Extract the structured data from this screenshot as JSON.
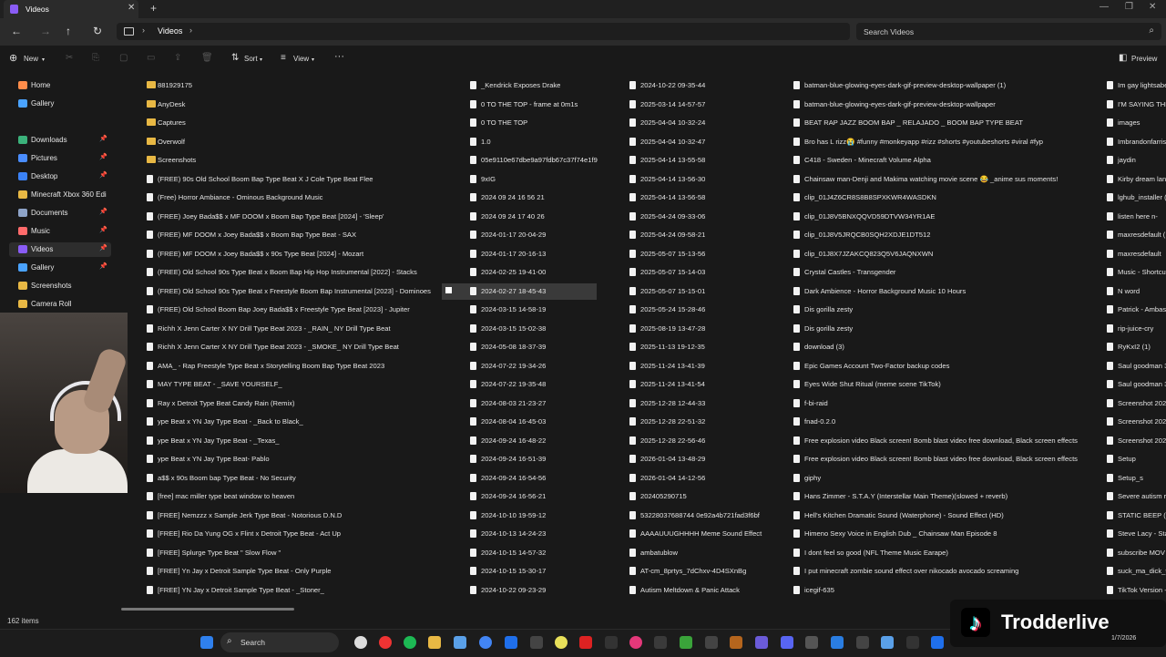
{
  "window": {
    "tab_title": "Videos",
    "new_tab": "+"
  },
  "address": {
    "crumb": "Videos",
    "search_placeholder": "Search Videos"
  },
  "toolbar": {
    "new": "New",
    "sort": "Sort",
    "view": "View",
    "more": "···",
    "preview": "Preview"
  },
  "sidebar": {
    "items": [
      {
        "label": "Home",
        "color": "#ff8c4a"
      },
      {
        "label": "Gallery",
        "color": "#4aa3ff"
      },
      {
        "label": "Downloads",
        "color": "#3bb27b"
      },
      {
        "label": "Pictures",
        "color": "#4a8dff"
      },
      {
        "label": "Desktop",
        "color": "#3b82f6"
      },
      {
        "label": "Minecraft Xbox 360 Edi",
        "color": "#e8b844"
      },
      {
        "label": "Documents",
        "color": "#8ea4c8"
      },
      {
        "label": "Music",
        "color": "#ff6b6b"
      },
      {
        "label": "Videos",
        "color": "#8a5cf6"
      },
      {
        "label": "Gallery",
        "color": "#4aa3ff"
      },
      {
        "label": "Screenshots",
        "color": "#e8b844"
      },
      {
        "label": "Camera Roll",
        "color": "#e8b844"
      }
    ]
  },
  "columns": [
    {
      "rows": [
        {
          "name": "881929175",
          "type": "folder"
        },
        {
          "name": "AnyDesk",
          "type": "folder"
        },
        {
          "name": "Captures",
          "type": "folder"
        },
        {
          "name": "Overwolf",
          "type": "folder"
        },
        {
          "name": "Screenshots",
          "type": "folder"
        },
        {
          "name": "(FREE) 90s Old School Boom Bap Type Beat X J Cole Type Beat  Flee",
          "type": "file"
        },
        {
          "name": "(Free) Horror Ambiance - Ominous Background Music",
          "type": "file"
        },
        {
          "name": "(FREE) Joey Bada$$ x MF DOOM x Boom Bap Type Beat [2024] - 'Sleep'",
          "type": "file"
        },
        {
          "name": "(FREE) MF DOOM x Joey Bada$$ x Boom Bap Type Beat -  SAX",
          "type": "file"
        },
        {
          "name": "(FREE) MF DOOM x Joey Bada$$ x 90s Type Beat [2024] -  Mozart",
          "type": "file"
        },
        {
          "name": "(FREE) Old School 90s Type Beat x Boom Bap Hip Hop Instrumental [2022] - Stacks",
          "type": "file"
        },
        {
          "name": "(FREE) Old School 90s Type Beat x Freestyle Boom Bap Instrumental [2023] - Dominoes",
          "type": "file"
        },
        {
          "name": "(FREE) Old School Boom Bap Joey Bada$$ x Freestyle Type Beat [2023] - Jupiter",
          "type": "file"
        },
        {
          "name": "Richh X Jenn Carter X NY Drill Type Beat 2023 - _RAIN_ NY Drill Type Beat",
          "type": "file"
        },
        {
          "name": "Richh X Jenn Carter X NY Drill Type Beat 2023 - _SMOKE_ NY Drill Type Beat",
          "type": "file"
        },
        {
          "name": "AMA_ - Rap Freestyle Type Beat x Storytelling Boom Bap Type Beat 2023",
          "type": "file"
        },
        {
          "name": "MAY TYPE BEAT - _SAVE YOURSELF_",
          "type": "file"
        },
        {
          "name": "Ray x Detroit Type Beat  Candy Rain  (Remix)",
          "type": "file"
        },
        {
          "name": "ype Beat x YN Jay Type Beat - _Back to Black_",
          "type": "file"
        },
        {
          "name": "ype Beat x YN Jay Type Beat - _Texas_",
          "type": "file"
        },
        {
          "name": "ype Beat x YN Jay Type Beat-  Pablo",
          "type": "file"
        },
        {
          "name": "a$$ x 90s Boom bap Type Beat -  No Security",
          "type": "file"
        },
        {
          "name": "[free] mac miller type beat  window to heaven",
          "type": "file"
        },
        {
          "name": "[FREE] Nemzzz x Sample Jerk Type Beat -  Notorious D.N.D",
          "type": "file"
        },
        {
          "name": "[FREE] Rio Da Yung OG x Flint x Detroit Type Beat -  Act Up",
          "type": "file"
        },
        {
          "name": "[FREE] Splurge Type Beat  \" Slow Flow \"",
          "type": "file"
        },
        {
          "name": "[FREE] Yn Jay x Detroit Sample Type Beat -  Only Purple",
          "type": "file"
        },
        {
          "name": "[FREE] YN Jay x Detroit Sample Type Beat - _Stoner_",
          "type": "file"
        }
      ]
    },
    {
      "rows": [
        {
          "name": "_Kendrick Exposes Drake",
          "type": "file"
        },
        {
          "name": "0 TO THE TOP - frame at 0m1s",
          "type": "file"
        },
        {
          "name": "0 TO THE TOP",
          "type": "file"
        },
        {
          "name": "1.0",
          "type": "file"
        },
        {
          "name": "05e9110e67dbe9a97fdb67c37f74e1f9",
          "type": "file"
        },
        {
          "name": "9xIG",
          "type": "file"
        },
        {
          "name": "2024 09 24 16 56 21",
          "type": "file"
        },
        {
          "name": "2024 09 24 17 40 26",
          "type": "file"
        },
        {
          "name": "2024-01-17 20-04-29",
          "type": "file"
        },
        {
          "name": "2024-01-17 20-16-13",
          "type": "file"
        },
        {
          "name": "2024-02-25 19-41-00",
          "type": "file"
        },
        {
          "name": "2024-02-27 18-45-43",
          "type": "file"
        },
        {
          "name": "2024-03-15 14-58-19",
          "type": "file"
        },
        {
          "name": "2024-03-15 15-02-38",
          "type": "file"
        },
        {
          "name": "2024-05-08 18-37-39",
          "type": "file"
        },
        {
          "name": "2024-07-22 19-34-26",
          "type": "file"
        },
        {
          "name": "2024-07-22 19-35-48",
          "type": "file"
        },
        {
          "name": "2024-08-03 21-23-27",
          "type": "file"
        },
        {
          "name": "2024-08-04 16-45-03",
          "type": "file"
        },
        {
          "name": "2024-09-24 16-48-22",
          "type": "file"
        },
        {
          "name": "2024-09-24 16-51-39",
          "type": "file"
        },
        {
          "name": "2024-09-24 16-54-56",
          "type": "file"
        },
        {
          "name": "2024-09-24 16-56-21",
          "type": "file"
        },
        {
          "name": "2024-10-10 19-59-12",
          "type": "file"
        },
        {
          "name": "2024-10-13 14-24-23",
          "type": "file"
        },
        {
          "name": "2024-10-15 14-57-32",
          "type": "file"
        },
        {
          "name": "2024-10-15 15-30-17",
          "type": "file"
        },
        {
          "name": "2024-10-22 09-23-29",
          "type": "file"
        }
      ]
    },
    {
      "rows": [
        {
          "name": "2024-10-22 09-35-44",
          "type": "file"
        },
        {
          "name": "2025-03-14 14-57-57",
          "type": "file"
        },
        {
          "name": "2025-04-04 10-32-24",
          "type": "file"
        },
        {
          "name": "2025-04-04 10-32-47",
          "type": "file"
        },
        {
          "name": "2025-04-14 13-55-58",
          "type": "file"
        },
        {
          "name": "2025-04-14 13-56-30",
          "type": "file"
        },
        {
          "name": "2025-04-14 13-56-58",
          "type": "file"
        },
        {
          "name": "2025-04-24 09-33-06",
          "type": "file"
        },
        {
          "name": "2025-04-24 09-58-21",
          "type": "file"
        },
        {
          "name": "2025-05-07 15-13-56",
          "type": "file"
        },
        {
          "name": "2025-05-07 15-14-03",
          "type": "file"
        },
        {
          "name": "2025-05-07 15-15-01",
          "type": "file"
        },
        {
          "name": "2025-05-24 15-28-46",
          "type": "file"
        },
        {
          "name": "2025-08-19 13-47-28",
          "type": "file"
        },
        {
          "name": "2025-11-13 19-12-35",
          "type": "file"
        },
        {
          "name": "2025-11-24 13-41-39",
          "type": "file"
        },
        {
          "name": "2025-11-24 13-41-54",
          "type": "file"
        },
        {
          "name": "2025-12-28 12-44-33",
          "type": "file"
        },
        {
          "name": "2025-12-28 22-51-32",
          "type": "file"
        },
        {
          "name": "2025-12-28 22-56-46",
          "type": "file"
        },
        {
          "name": "2026-01-04 13-48-29",
          "type": "file"
        },
        {
          "name": "2026-01-04 14-12-56",
          "type": "file"
        },
        {
          "name": "202405290715",
          "type": "file"
        },
        {
          "name": "53228037688744 0e92a4b721fad3f6bf",
          "type": "file"
        },
        {
          "name": "AAAAUUUGHHHH Meme Sound Effect",
          "type": "file"
        },
        {
          "name": "ambatublow",
          "type": "file"
        },
        {
          "name": "AT-cm_8prtys_7dChxv-4D4SXnBg",
          "type": "file"
        },
        {
          "name": "Autism Meltdown & Panic Attack",
          "type": "file"
        }
      ]
    },
    {
      "rows": [
        {
          "name": "batman-blue-glowing-eyes-dark-gif-preview-desktop-wallpaper (1)",
          "type": "file"
        },
        {
          "name": "batman-blue-glowing-eyes-dark-gif-preview-desktop-wallpaper",
          "type": "file"
        },
        {
          "name": "BEAT RAP JAZZ BOOM BAP _ RELAJADO _ BOOM BAP TYPE BEAT",
          "type": "file"
        },
        {
          "name": "Bro has L rizz😭 #funny #monkeyapp #rizz #shorts #youtubeshorts #viral #fyp",
          "type": "file"
        },
        {
          "name": "C418  - Sweden - Minecraft Volume Alpha",
          "type": "file"
        },
        {
          "name": "Chainsaw man-Denji and Makima watching movie scene 😂 _anime sus moments!",
          "type": "file"
        },
        {
          "name": "clip_01J4Z6CR8S8B8SPXKWR4WASDKN",
          "type": "file"
        },
        {
          "name": "clip_01J8V5BNXQQVD59DTVW34YR1AE",
          "type": "file"
        },
        {
          "name": "clip_01J8V5JRQCB0SQH2XDJE1DT512",
          "type": "file"
        },
        {
          "name": "clip_01J8X7JZAKCQ823Q5V6JAQNXWN",
          "type": "file"
        },
        {
          "name": "Crystal Castles - Transgender",
          "type": "file"
        },
        {
          "name": "Dark Ambience - Horror Background Music 10 Hours",
          "type": "file"
        },
        {
          "name": "Dis gorilla zesty",
          "type": "file"
        },
        {
          "name": "Dis gorilla zesty",
          "type": "file"
        },
        {
          "name": "download (3)",
          "type": "file"
        },
        {
          "name": "Epic Games Account Two-Factor backup codes",
          "type": "file"
        },
        {
          "name": "Eyes Wide Shut Ritual (meme scene TikTok)",
          "type": "file"
        },
        {
          "name": "f-bi-raid",
          "type": "file"
        },
        {
          "name": "fnad-0.2.0",
          "type": "file"
        },
        {
          "name": "Free explosion video Black screen! Bomb blast video free download, Black screen effects",
          "type": "file"
        },
        {
          "name": "Free explosion video Black screen! Bomb blast video free download, Black screen effects",
          "type": "file"
        },
        {
          "name": "giphy",
          "type": "file"
        },
        {
          "name": "Hans Zimmer - S.T.A.Y (Interstellar Main Theme)(slowed + reverb)",
          "type": "file"
        },
        {
          "name": "Hell's Kitchen Dramatic Sound (Waterphone) - Sound Effect (HD)",
          "type": "file"
        },
        {
          "name": "Himeno Sexy Voice in English Dub _ Chainsaw Man Episode 8",
          "type": "file"
        },
        {
          "name": "I dont feel so good (NFL Theme Music Earape)",
          "type": "file"
        },
        {
          "name": "I put minecraft zombie sound effect over nikocado avocado screaming",
          "type": "file"
        },
        {
          "name": "icegif-635",
          "type": "file"
        }
      ]
    },
    {
      "rows": [
        {
          "name": "Im gay lightsabe",
          "type": "file"
        },
        {
          "name": "I'M SAYING THE",
          "type": "file"
        },
        {
          "name": "images",
          "type": "file"
        },
        {
          "name": "Imbrandonfarris",
          "type": "file"
        },
        {
          "name": "jaydin",
          "type": "file"
        },
        {
          "name": "Kirby dream lan",
          "type": "file"
        },
        {
          "name": "lghub_installer (",
          "type": "file"
        },
        {
          "name": "listen here n-",
          "type": "file"
        },
        {
          "name": "maxresdefault (",
          "type": "file"
        },
        {
          "name": "maxresdefault",
          "type": "file"
        },
        {
          "name": "Music - Shortcut",
          "type": "file"
        },
        {
          "name": "N word",
          "type": "file"
        },
        {
          "name": "Patrick - Ambasi",
          "type": "file"
        },
        {
          "name": "rip-juice-cry",
          "type": "file"
        },
        {
          "name": "RyKxI2 (1)",
          "type": "file"
        },
        {
          "name": "Saul goodman 3",
          "type": "file"
        },
        {
          "name": "Saul goodman 3",
          "type": "file"
        },
        {
          "name": "Screenshot 2024",
          "type": "file"
        },
        {
          "name": "Screenshot 2024",
          "type": "file"
        },
        {
          "name": "Screenshot 2024",
          "type": "file"
        },
        {
          "name": "Setup",
          "type": "file"
        },
        {
          "name": "Setup_s",
          "type": "file"
        },
        {
          "name": "Severe autism ra",
          "type": "file"
        },
        {
          "name": "STATIC BEEP (N",
          "type": "file"
        },
        {
          "name": "Steve Lacy - Stat",
          "type": "file"
        },
        {
          "name": "subscribe MOV",
          "type": "file"
        },
        {
          "name": "suck_ma_dick_tr",
          "type": "file"
        },
        {
          "name": "TikTok Version -",
          "type": "file"
        }
      ]
    }
  ],
  "status": {
    "items_count": "162 items"
  },
  "taskbar": {
    "search_label": "Search"
  },
  "overlay": {
    "tiktok_name": "Trodderlive"
  },
  "clock": {
    "date": "1/7/2026"
  }
}
